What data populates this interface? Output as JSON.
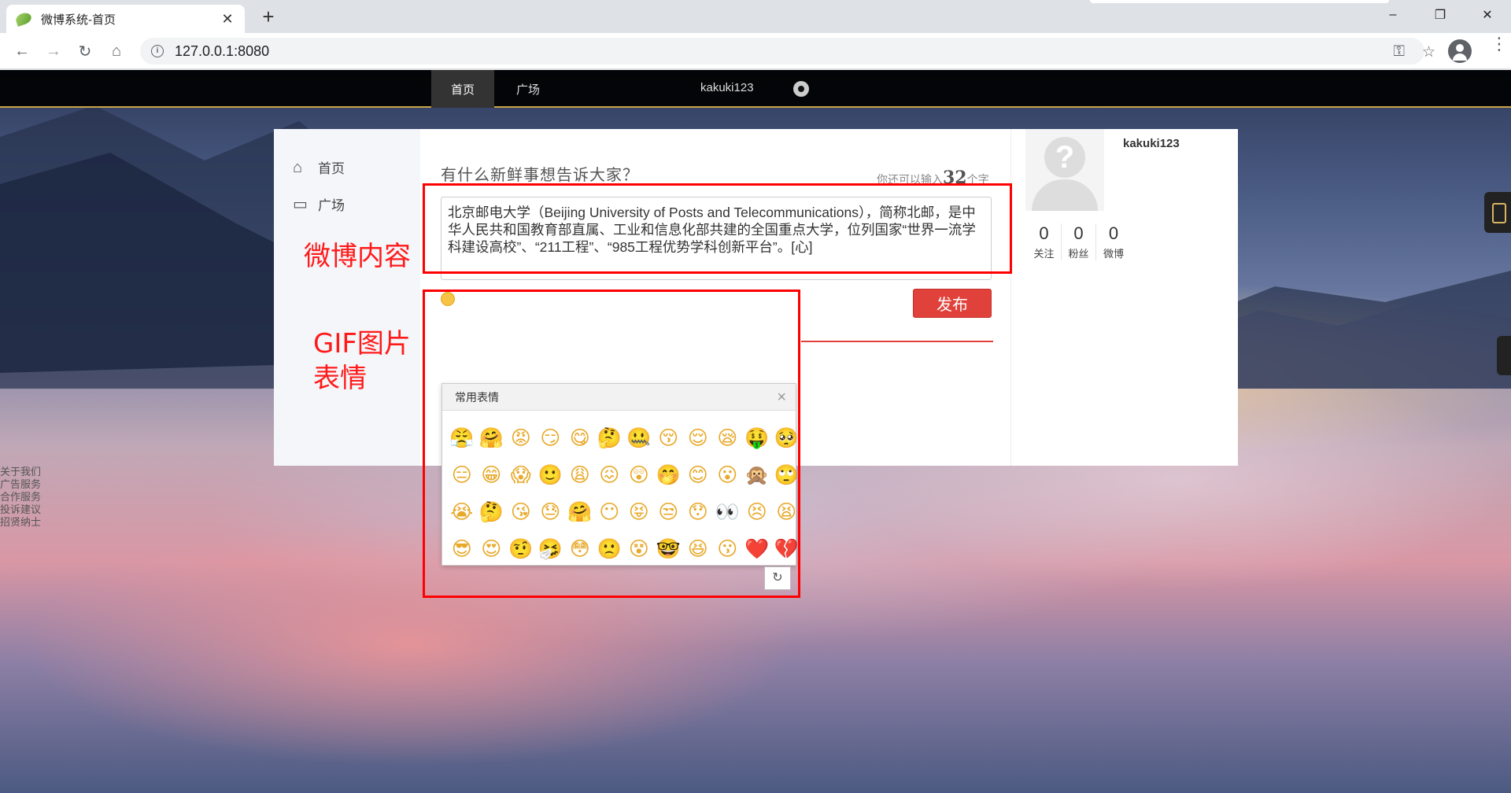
{
  "browser": {
    "tab_title": "微博系统-首页",
    "tab_close": "✕",
    "new_tab": "+",
    "url": "127.0.0.1:8080",
    "window_controls": [
      "–",
      "❐",
      "✕"
    ]
  },
  "nav": {
    "home": "首页",
    "plaza": "广场",
    "username": "kakuki123"
  },
  "sidebar": {
    "items": [
      {
        "label": "首页",
        "icon": "home-icon"
      },
      {
        "label": "广场",
        "icon": "comment-icon"
      }
    ]
  },
  "composer": {
    "prompt": "有什么新鲜事想告诉大家？",
    "counter_prefix": "你还可以输入",
    "counter_value": "32",
    "counter_suffix": "个字",
    "content": "北京邮电大学（Beijing University of Posts and Telecommunications），简称北邮，是中华人民共和国教育部直属、工业和信息化部共建的全国重点大学，位列国家“世界一流学科建设高校”、“211工程”、“985工程优势学科创新平台”。[心]",
    "publish_label": "发布"
  },
  "emoji_panel": {
    "title": "常用表情",
    "close": "×",
    "emojis": [
      "😤",
      "🤗",
      "😡",
      "😏",
      "😋",
      "🤔",
      "🤐",
      "😚",
      "😌",
      "😪",
      "🤑",
      "🥺",
      "😑",
      "😁",
      "😱",
      "🙂",
      "😩",
      "😖",
      "😲",
      "🤭",
      "😊",
      "😮",
      "🙊",
      "🙄",
      "😭",
      "🤔",
      "😘",
      "😓",
      "🤗",
      "😶",
      "😝",
      "😒",
      "😯",
      "👀",
      "😣",
      "😫",
      "😎",
      "😍",
      "🤨",
      "🤧",
      "😳",
      "🙁",
      "😵",
      "🤓",
      "😆",
      "😗",
      "❤️",
      "💔"
    ],
    "scroll_button": "↻"
  },
  "profile": {
    "username": "kakuki123",
    "avatar_glyph": "?",
    "stats": [
      {
        "value": "0",
        "label": "关注"
      },
      {
        "value": "0",
        "label": "粉丝"
      },
      {
        "value": "0",
        "label": "微博"
      }
    ]
  },
  "annotations": {
    "content_label": "微博内容",
    "gif_label_line1": "GIF图片",
    "gif_label_line2": "表情"
  },
  "footer_links": [
    "关于我们",
    "广告服务",
    "合作服务",
    "投诉建议",
    "招贤纳士"
  ]
}
